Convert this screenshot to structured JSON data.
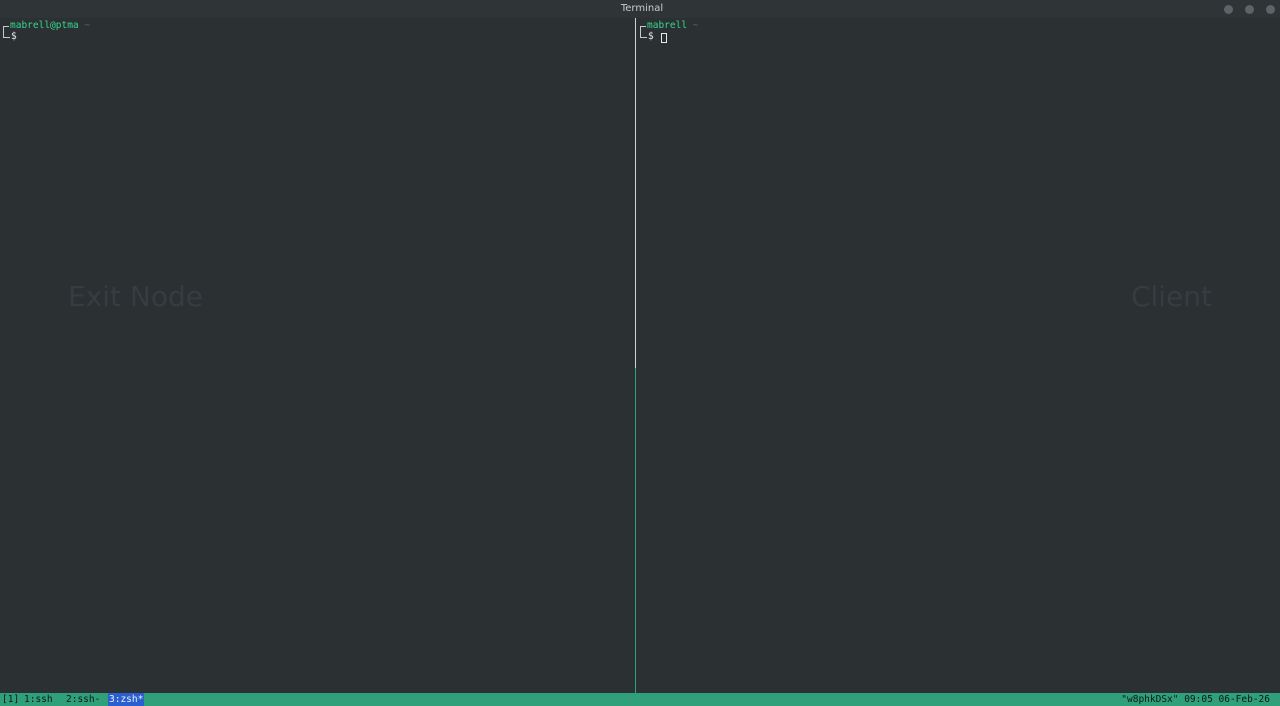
{
  "window": {
    "title": "Terminal",
    "buttons": [
      "minimize",
      "maximize",
      "close"
    ]
  },
  "panes": [
    {
      "user": "mabrell@ptma",
      "path": "~",
      "prompt": "$",
      "watermark": "Exit Node"
    },
    {
      "user": "mabrell",
      "path": "~",
      "prompt": "$",
      "watermark": "Client"
    }
  ],
  "statusbar": {
    "session": "[1]",
    "windows": [
      {
        "label": "1:ssh",
        "active": false
      },
      {
        "label": "2:ssh-",
        "active": false
      },
      {
        "label": "3:zsh*",
        "active": true
      }
    ],
    "right": "\"w8phkDSx\" 09:05 06-Feb-26"
  },
  "colors": {
    "background": "#2b3033",
    "status_green": "#2fa07a",
    "active_window": "#2a5fd0",
    "prompt_user": "#38d68c"
  },
  "icons": {
    "minimize": "circle-button-icon",
    "maximize": "circle-button-icon",
    "close": "circle-button-icon"
  }
}
